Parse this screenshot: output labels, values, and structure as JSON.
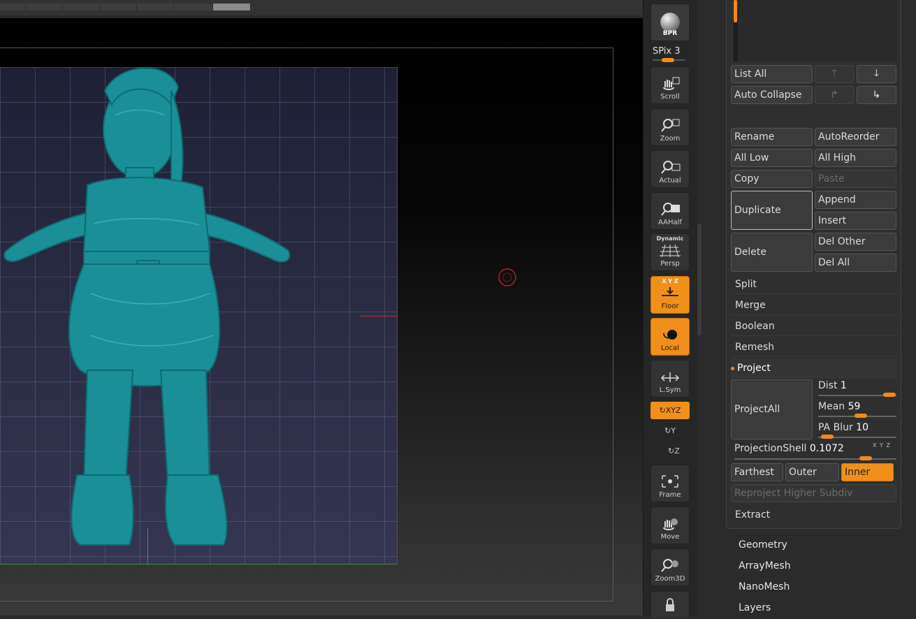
{
  "shelf": {
    "bpr": "BPR",
    "spix_label": "SPix",
    "spix_value": "3",
    "spix_level": 0.35,
    "buttons": [
      {
        "label": "Scroll",
        "icon": "hand-scroll-icon",
        "active": false
      },
      {
        "label": "Zoom",
        "icon": "zoom-magnifier-icon",
        "active": false
      },
      {
        "label": "Actual",
        "icon": "actual-size-icon",
        "active": false
      },
      {
        "label": "AAHalf",
        "icon": "aahalf-icon",
        "active": false
      },
      {
        "label": "Persp",
        "icon": "perspective-grid-icon",
        "active": false,
        "top_text": "Dynamic"
      },
      {
        "label": "Floor",
        "icon": "floor-grid-icon",
        "active": true,
        "top_text": "X Y Z"
      },
      {
        "label": "Local",
        "icon": "local-transform-icon",
        "active": true
      },
      {
        "label": "L.Sym",
        "icon": "local-symmetry-icon",
        "active": false
      }
    ],
    "xyz_label": "XYZ",
    "rot_y": "Y",
    "rot_z": "Z",
    "buttons2": [
      {
        "label": "Frame",
        "icon": "frame-icon",
        "active": false
      },
      {
        "label": "Move",
        "icon": "move-hand-icon",
        "active": false
      },
      {
        "label": "Zoom3D",
        "icon": "zoom3d-icon",
        "active": false
      }
    ]
  },
  "subtool": {
    "list_all": "List All",
    "auto_collapse": "Auto Collapse",
    "rename": "Rename",
    "auto_reorder": "AutoReorder",
    "all_low": "All Low",
    "all_high": "All High",
    "copy": "Copy",
    "paste": "Paste",
    "duplicate": "Duplicate",
    "append": "Append",
    "insert": "Insert",
    "delete": "Delete",
    "del_other": "Del Other",
    "del_all": "Del All",
    "split": "Split",
    "merge": "Merge",
    "boolean": "Boolean",
    "remesh": "Remesh",
    "project": "Project",
    "project_all": "ProjectAll",
    "dist_label": "Dist",
    "dist_value": "1",
    "mean_label": "Mean",
    "mean_value": "59",
    "pablur_label": "PA Blur",
    "pablur_value": "10",
    "projection_shell_label": "ProjectionShell",
    "projection_shell_value": "0.1072",
    "farthest": "Farthest",
    "outer": "Outer",
    "inner": "Inner",
    "reproject": "Reproject Higher Subdiv",
    "extract": "Extract",
    "xyz_mini": "X Y Z"
  },
  "sections": [
    "Geometry",
    "ArrayMesh",
    "NanoMesh",
    "Layers"
  ],
  "colors": {
    "accent": "#f0901a",
    "model": "#1a8f98",
    "panel": "#2b2b2b"
  }
}
